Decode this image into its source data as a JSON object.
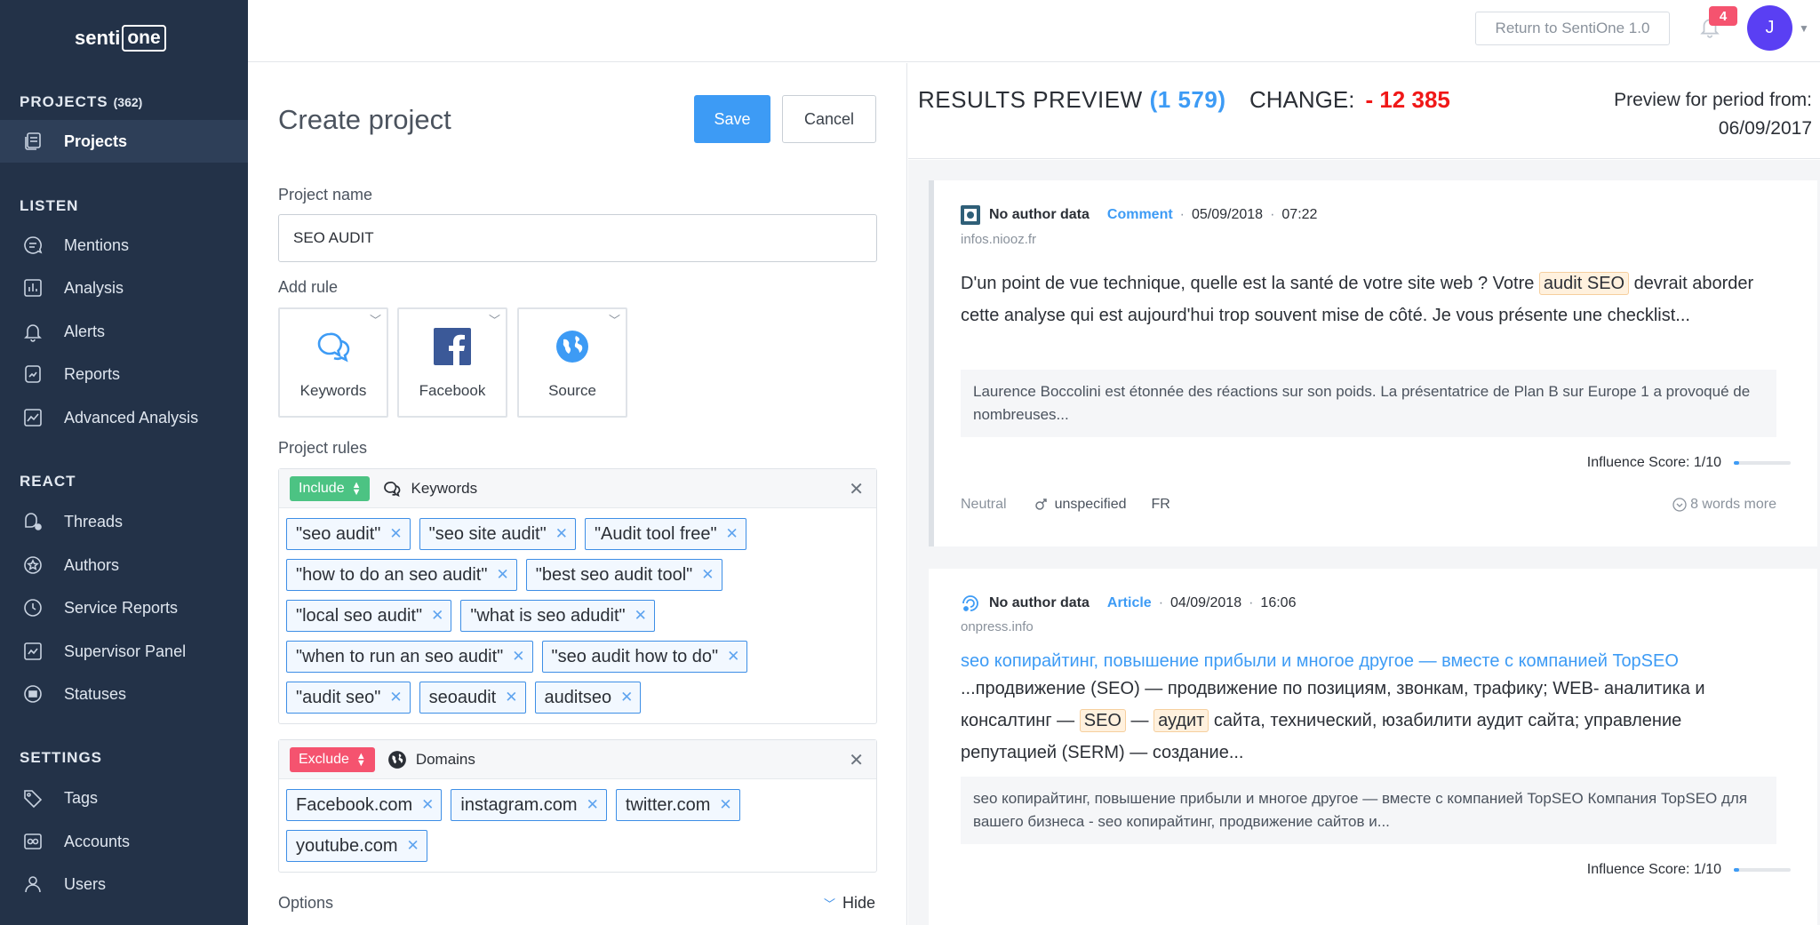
{
  "app": {
    "logo_text": "senti",
    "logo_badge": "one"
  },
  "sidebar": {
    "projects_title": "PROJECTS",
    "projects_count": "(362)",
    "projects_item": "Projects",
    "listen_title": "LISTEN",
    "listen_items": [
      "Mentions",
      "Analysis",
      "Alerts",
      "Reports",
      "Advanced Analysis"
    ],
    "react_title": "REACT",
    "react_items": [
      "Threads",
      "Authors",
      "Service Reports",
      "Supervisor Panel",
      "Statuses"
    ],
    "settings_title": "SETTINGS",
    "settings_items": [
      "Tags",
      "Accounts",
      "Users"
    ]
  },
  "topbar": {
    "return_label": "Return to SentiOne 1.0",
    "notification_count": "4",
    "avatar_initial": "J"
  },
  "create": {
    "title": "Create project",
    "save_label": "Save",
    "cancel_label": "Cancel",
    "project_name_label": "Project name",
    "project_name_value": "SEO AUDIT",
    "add_rule_label": "Add rule",
    "rule_types": [
      "Keywords",
      "Facebook",
      "Source"
    ],
    "project_rules_label": "Project rules",
    "include_rule": {
      "mode": "Include",
      "type": "Keywords",
      "tags": [
        "\"seo audit\"",
        "\"seo site audit\"",
        "\"Audit tool free\"",
        "\"how to do an seo audit\"",
        "\"best seo audit tool\"",
        "\"local seo audit\"",
        "\"what is seo adudit\"",
        "\"when to run an seo audit\"",
        "\"seo audit how to do\"",
        "\"audit seo\"",
        "seoaudit",
        "auditseo"
      ]
    },
    "exclude_rule": {
      "mode": "Exclude",
      "type": "Domains",
      "tags": [
        "Facebook.com",
        "instagram.com",
        "twitter.com",
        "youtube.com"
      ]
    },
    "options_label": "Options",
    "hide_label": "Hide"
  },
  "preview": {
    "title": "RESULTS PREVIEW",
    "count": "(1 579)",
    "change_label": "CHANGE:",
    "change_value": "- 12 385",
    "period_label": "Preview for period from:",
    "period_date": "06/09/2017"
  },
  "results": [
    {
      "author": "No author data",
      "type": "Comment",
      "date": "05/09/2018",
      "time": "07:22",
      "source": "infos.niooz.fr",
      "body_pre": "D'un point de vue technique, quelle est la santé de votre site web ? Votre ",
      "body_hl": "audit SEO",
      "body_post": " devrait aborder cette analyse qui est aujourd'hui trop souvent mise de côté. Je vous présente une checklist...",
      "quote": "Laurence Boccolini est étonnée des réactions sur son poids. La présentatrice de Plan B sur Europe 1 a provoqué de nombreuses...",
      "influence": "Influence Score: 1/10",
      "influence_level": 0.1,
      "sentiment": "Neutral",
      "gender": "unspecified",
      "lang": "FR",
      "more": "8 words more"
    },
    {
      "author": "No author data",
      "type": "Article",
      "date": "04/09/2018",
      "time": "16:06",
      "source": "onpress.info",
      "title": "seo копирайтинг, повышение прибыли и многое другое — вместе с компанией TopSEO",
      "body_a": "...продвижение (SEO) — продвижение по позициям, звонкам, трафику; WEB- аналитика и консалтинг — ",
      "body_hl1": "SEO",
      "body_b": " — ",
      "body_hl2": "аудит",
      "body_c": " сайта, технический, юзабилити аудит сайта; управление репутацией (SERM) — создание...",
      "quote": "seo копирайтинг, повышение прибыли и многое другое — вместе с компанией TopSEO Компания TopSEO для вашего бизнеса - seo копирайтинг, продвижение сайтов и...",
      "influence": "Influence Score: 1/10",
      "influence_level": 0.1
    }
  ],
  "colors": {
    "sidebar_bg": "#233248",
    "accent": "#3d9bf5",
    "include": "#4cc383",
    "exclude": "#f5536f",
    "change_negative": "#f01818"
  }
}
